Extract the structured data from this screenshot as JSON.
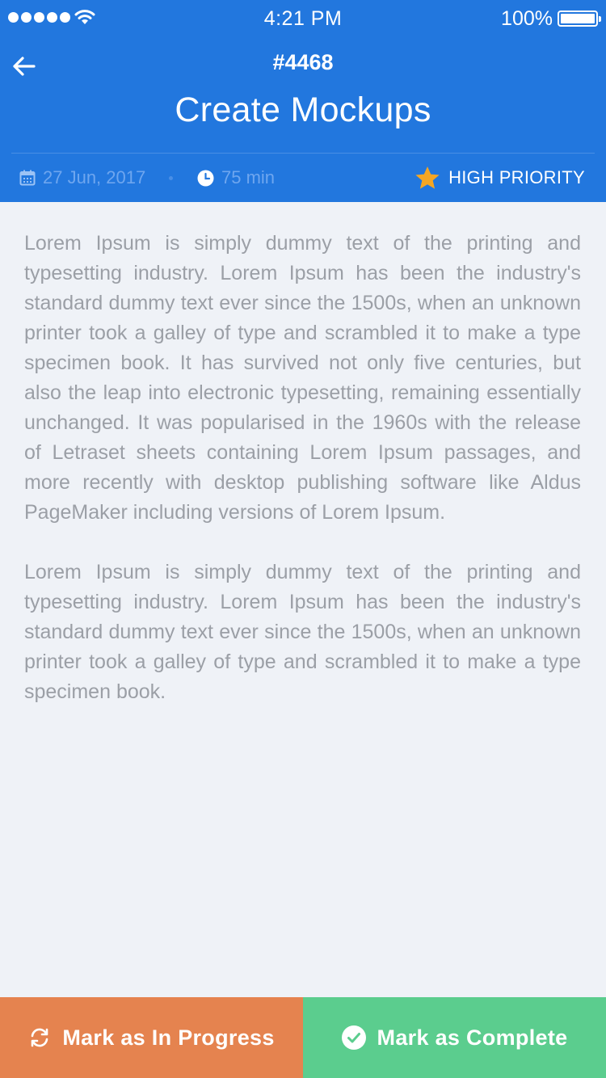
{
  "status_bar": {
    "time": "4:21 PM",
    "battery": "100%"
  },
  "task": {
    "id": "#4468",
    "title": "Create Mockups",
    "date": "27 Jun, 2017",
    "duration": "75 min",
    "priority": "HIGH PRIORITY"
  },
  "description": {
    "paragraph_1": "Lorem Ipsum is simply dummy text of the printing and typesetting industry. Lorem Ipsum has been the industry's standard dummy text ever since the 1500s, when an unknown printer took a galley of type and scrambled it to make a type specimen book. It has survived not only five centuries, but also the leap into electronic typesetting, remaining essentially unchanged. It was popularised in the 1960s with the release of Letraset sheets containing Lorem Ipsum passages, and more recently with desktop publishing software like Aldus PageMaker including versions of Lorem Ipsum.",
    "paragraph_2": "Lorem Ipsum is simply dummy text of the printing and typesetting industry. Lorem Ipsum has been the industry's standard dummy text ever since the 1500s, when an unknown printer took a galley of type and scrambled it to make a type specimen book."
  },
  "actions": {
    "in_progress_label": "Mark as In Progress",
    "complete_label": "Mark as Complete"
  },
  "colors": {
    "header": "#2277de",
    "star": "#f5a623",
    "in_progress": "#e5834f",
    "complete": "#5bcd8e",
    "background": "#eff2f7"
  },
  "icons": {
    "back": "arrow-left-icon",
    "date": "calendar-icon",
    "duration": "clock-icon",
    "priority": "star-icon",
    "in_progress": "refresh-icon",
    "complete": "check-circle-icon"
  }
}
